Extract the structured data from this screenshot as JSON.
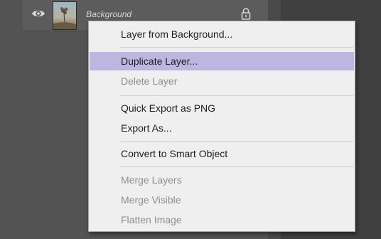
{
  "layer": {
    "name": "Background",
    "visible": true,
    "locked": true
  },
  "context_menu": {
    "items": [
      {
        "label": "Layer from Background...",
        "enabled": true
      },
      {
        "label": "Duplicate Layer...",
        "enabled": true,
        "highlighted": true
      },
      {
        "label": "Delete Layer",
        "enabled": false
      },
      {
        "label": "Quick Export as PNG",
        "enabled": true
      },
      {
        "label": "Export As...",
        "enabled": true
      },
      {
        "label": "Convert to Smart Object",
        "enabled": true
      },
      {
        "label": "Merge Layers",
        "enabled": false
      },
      {
        "label": "Merge Visible",
        "enabled": false
      },
      {
        "label": "Flatten Image",
        "enabled": false
      }
    ]
  },
  "colors": {
    "highlight": "#bdb6e2",
    "menu_background": "#efefef",
    "panel_background": "#535353",
    "disabled_text": "#8e8e8e"
  },
  "icons": [
    "eye-icon",
    "lock-icon"
  ]
}
